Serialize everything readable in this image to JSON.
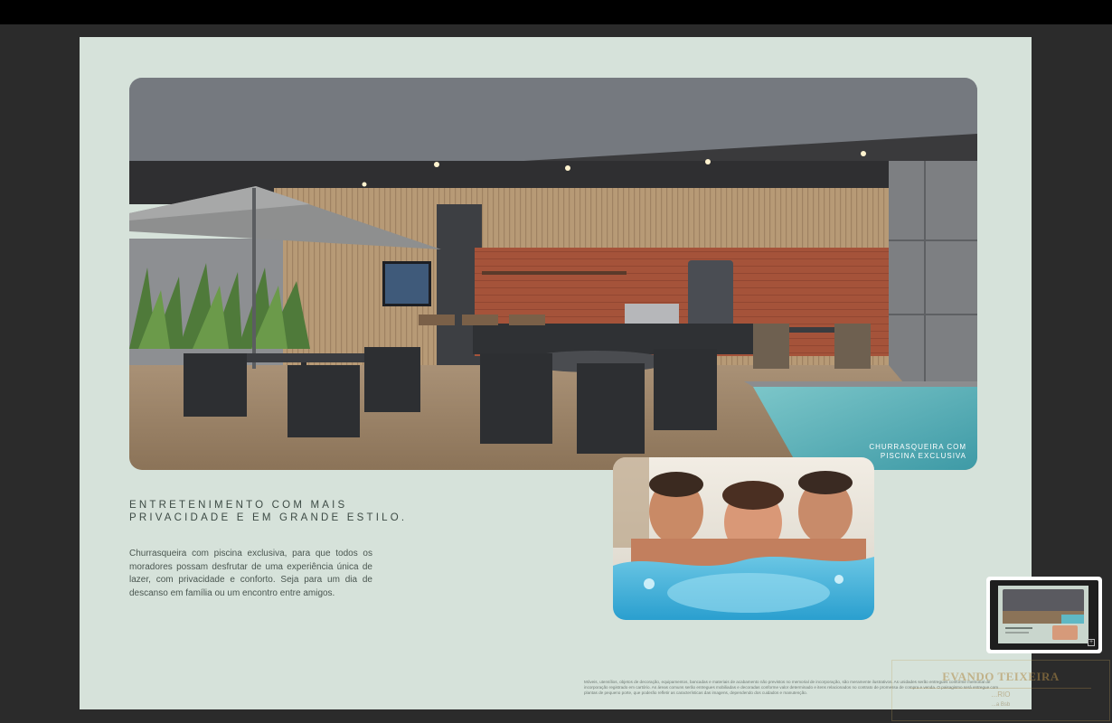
{
  "page": {
    "heading_line1": "ENTRETENIMENTO COM MAIS",
    "heading_line2": "PRIVACIDADE E EM GRANDE ESTILO.",
    "body": "Churrasqueira com piscina exclusiva, para que todos os moradores possam desfrutar de uma experiência única de lazer, com privacidade e conforto. Seja para um dia de descanso em família ou um encontro entre amigos.",
    "hero_caption_line1": "CHURRASQUEIRA COM",
    "hero_caption_line2": "PISCINA EXCLUSIVA",
    "disclaimer": "Móveis, utensílios, objetos de decoração, equipamentos, bancadas e materiais de acabamento não previstos no memorial de incorporação, são meramente ilustrativos. As unidades serão entregues conforme memorial de incorporação registrado em cartório. As áreas comuns serão entregues mobiliadas e decoradas conforme valor determinado e itens relacionados no contrato de promessa de compra e venda. O paisagismo será entregue com plantas de pequeno porte, que poderão refletir as características das imagens, dependendo dos cuidados e manutenção."
  },
  "watermark": {
    "name": "EVANDO TEIXEIRA",
    "sub": "...RIO",
    "sub2": "...a Bsb"
  },
  "colors": {
    "page_bg": "#d6e2da",
    "viewer_bg": "#2b2b2b",
    "text": "#3d4b45",
    "pool": "#5fb8c4",
    "accent_wall": "#9a4a33"
  },
  "icons": {
    "thumb_expand": "expand-icon"
  }
}
